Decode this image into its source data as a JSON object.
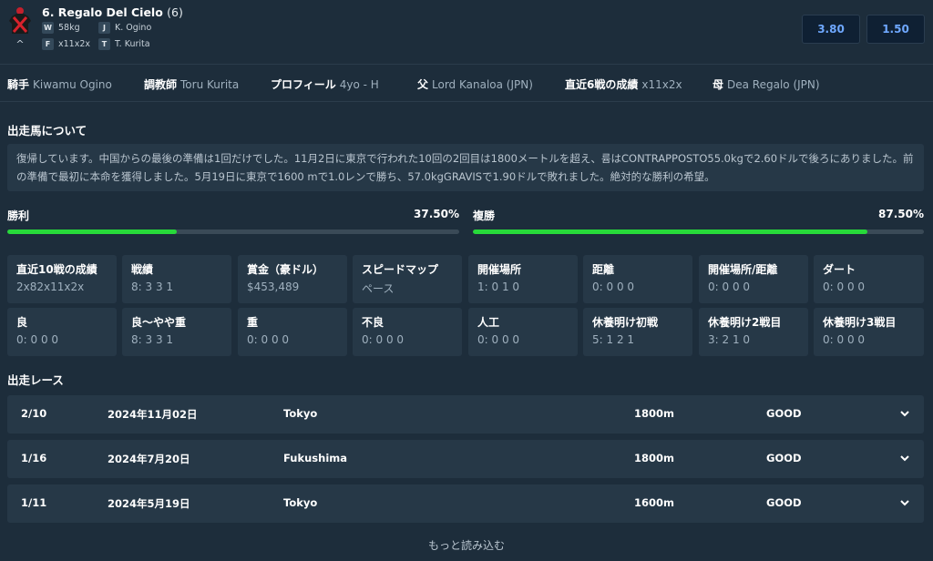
{
  "horse": {
    "name": "6. Regalo Del Cielo",
    "number": "(6)",
    "silk_icon": "jockey-silk-icon",
    "weight_tag": "W",
    "weight": "58kg",
    "jockey_tag": "J",
    "jockey": "K. Ogino",
    "form_tag": "F",
    "form": "x11x2x",
    "trainer_tag": "T",
    "trainer": "T. Kurita",
    "collapse_icon": "chevron-up-icon"
  },
  "odds": {
    "win": "3.80",
    "place": "1.50"
  },
  "info": [
    {
      "key": "騎手",
      "value": "Kiwamu Ogino"
    },
    {
      "key": "調教師",
      "value": "Toru Kurita"
    },
    {
      "key": "プロフィール",
      "value": "4yo - H"
    },
    {
      "key": "父",
      "value": "Lord Kanaloa (JPN)"
    },
    {
      "key": "直近6戦の成績",
      "value": "x11x2x"
    },
    {
      "key": "母",
      "value": "Dea Regalo (JPN)"
    }
  ],
  "about": {
    "title": "出走馬について",
    "text": "復帰しています。中国からの最後の準備は1回だけでした。11月2日に東京で行われた10回の2回目は1800メートルを超え、륨はCONTRAPPOSTO55.0kgで2.60ドルで後ろにありました。前の準備で最初に本命を獲得しました。5月19日に東京で1600 mで1.0レンで勝ち、57.0kgGRAVISで1.90ドルで敗れました。絶対的な勝利の希望。"
  },
  "progress": {
    "win_label": "勝利",
    "win_value": "37.50%",
    "win_fraction": 0.375,
    "place_label": "複勝",
    "place_value": "87.50%",
    "place_fraction": 0.875,
    "fill_color": "#27d93a"
  },
  "stats": [
    {
      "key": "直近10戦の成績",
      "value": "2x82x11x2x"
    },
    {
      "key": "戦績",
      "value": "8: 3 3 1"
    },
    {
      "key": "賞金（豪ドル）",
      "value": "$453,489"
    },
    {
      "key": "スピードマップ",
      "value": "ペース"
    },
    {
      "key": "開催場所",
      "value": "1: 0 1 0"
    },
    {
      "key": "距離",
      "value": "0: 0 0 0"
    },
    {
      "key": "開催場所/距離",
      "value": "0: 0 0 0"
    },
    {
      "key": "ダート",
      "value": "0: 0 0 0"
    },
    {
      "key": "良",
      "value": "0: 0 0 0"
    },
    {
      "key": "良～やや重",
      "value": "8: 3 3 1"
    },
    {
      "key": "重",
      "value": "0: 0 0 0"
    },
    {
      "key": "不良",
      "value": "0: 0 0 0"
    },
    {
      "key": "人工",
      "value": "0: 0 0 0"
    },
    {
      "key": "休養明け初戦",
      "value": "5: 1 2 1"
    },
    {
      "key": "休養明け2戦目",
      "value": "3: 2 1 0"
    },
    {
      "key": "休養明け3戦目",
      "value": "0: 0 0 0"
    }
  ],
  "races": {
    "title": "出走レース",
    "rows": [
      {
        "pos": "2/10",
        "date": "2024年11月02日",
        "venue": "Tokyo",
        "distance": "1800m",
        "going": "GOOD"
      },
      {
        "pos": "1/16",
        "date": "2024年7月20日",
        "venue": "Fukushima",
        "distance": "1800m",
        "going": "GOOD"
      },
      {
        "pos": "1/11",
        "date": "2024年5月19日",
        "venue": "Tokyo",
        "distance": "1600m",
        "going": "GOOD"
      }
    ],
    "expand_icon": "chevron-down-icon"
  },
  "load_more": "もっと読み込む",
  "colors": {
    "background": "#1d2d3b",
    "panel": "#263847",
    "odds_text": "#6fa8ff",
    "progress": "#27d93a"
  }
}
